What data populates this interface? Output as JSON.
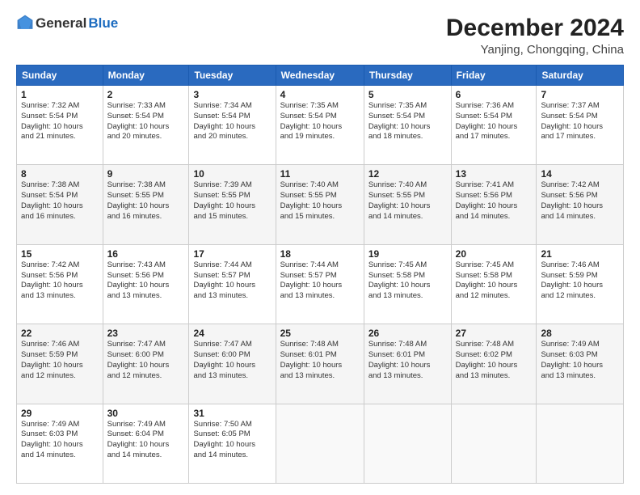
{
  "header": {
    "logo_general": "General",
    "logo_blue": "Blue",
    "month_title": "December 2024",
    "location": "Yanjing, Chongqing, China"
  },
  "days_of_week": [
    "Sunday",
    "Monday",
    "Tuesday",
    "Wednesday",
    "Thursday",
    "Friday",
    "Saturday"
  ],
  "weeks": [
    [
      {
        "day": "1",
        "info": "Sunrise: 7:32 AM\nSunset: 5:54 PM\nDaylight: 10 hours\nand 21 minutes."
      },
      {
        "day": "2",
        "info": "Sunrise: 7:33 AM\nSunset: 5:54 PM\nDaylight: 10 hours\nand 20 minutes."
      },
      {
        "day": "3",
        "info": "Sunrise: 7:34 AM\nSunset: 5:54 PM\nDaylight: 10 hours\nand 20 minutes."
      },
      {
        "day": "4",
        "info": "Sunrise: 7:35 AM\nSunset: 5:54 PM\nDaylight: 10 hours\nand 19 minutes."
      },
      {
        "day": "5",
        "info": "Sunrise: 7:35 AM\nSunset: 5:54 PM\nDaylight: 10 hours\nand 18 minutes."
      },
      {
        "day": "6",
        "info": "Sunrise: 7:36 AM\nSunset: 5:54 PM\nDaylight: 10 hours\nand 17 minutes."
      },
      {
        "day": "7",
        "info": "Sunrise: 7:37 AM\nSunset: 5:54 PM\nDaylight: 10 hours\nand 17 minutes."
      }
    ],
    [
      {
        "day": "8",
        "info": "Sunrise: 7:38 AM\nSunset: 5:54 PM\nDaylight: 10 hours\nand 16 minutes."
      },
      {
        "day": "9",
        "info": "Sunrise: 7:38 AM\nSunset: 5:55 PM\nDaylight: 10 hours\nand 16 minutes."
      },
      {
        "day": "10",
        "info": "Sunrise: 7:39 AM\nSunset: 5:55 PM\nDaylight: 10 hours\nand 15 minutes."
      },
      {
        "day": "11",
        "info": "Sunrise: 7:40 AM\nSunset: 5:55 PM\nDaylight: 10 hours\nand 15 minutes."
      },
      {
        "day": "12",
        "info": "Sunrise: 7:40 AM\nSunset: 5:55 PM\nDaylight: 10 hours\nand 14 minutes."
      },
      {
        "day": "13",
        "info": "Sunrise: 7:41 AM\nSunset: 5:56 PM\nDaylight: 10 hours\nand 14 minutes."
      },
      {
        "day": "14",
        "info": "Sunrise: 7:42 AM\nSunset: 5:56 PM\nDaylight: 10 hours\nand 14 minutes."
      }
    ],
    [
      {
        "day": "15",
        "info": "Sunrise: 7:42 AM\nSunset: 5:56 PM\nDaylight: 10 hours\nand 13 minutes."
      },
      {
        "day": "16",
        "info": "Sunrise: 7:43 AM\nSunset: 5:56 PM\nDaylight: 10 hours\nand 13 minutes."
      },
      {
        "day": "17",
        "info": "Sunrise: 7:44 AM\nSunset: 5:57 PM\nDaylight: 10 hours\nand 13 minutes."
      },
      {
        "day": "18",
        "info": "Sunrise: 7:44 AM\nSunset: 5:57 PM\nDaylight: 10 hours\nand 13 minutes."
      },
      {
        "day": "19",
        "info": "Sunrise: 7:45 AM\nSunset: 5:58 PM\nDaylight: 10 hours\nand 13 minutes."
      },
      {
        "day": "20",
        "info": "Sunrise: 7:45 AM\nSunset: 5:58 PM\nDaylight: 10 hours\nand 12 minutes."
      },
      {
        "day": "21",
        "info": "Sunrise: 7:46 AM\nSunset: 5:59 PM\nDaylight: 10 hours\nand 12 minutes."
      }
    ],
    [
      {
        "day": "22",
        "info": "Sunrise: 7:46 AM\nSunset: 5:59 PM\nDaylight: 10 hours\nand 12 minutes."
      },
      {
        "day": "23",
        "info": "Sunrise: 7:47 AM\nSunset: 6:00 PM\nDaylight: 10 hours\nand 12 minutes."
      },
      {
        "day": "24",
        "info": "Sunrise: 7:47 AM\nSunset: 6:00 PM\nDaylight: 10 hours\nand 13 minutes."
      },
      {
        "day": "25",
        "info": "Sunrise: 7:48 AM\nSunset: 6:01 PM\nDaylight: 10 hours\nand 13 minutes."
      },
      {
        "day": "26",
        "info": "Sunrise: 7:48 AM\nSunset: 6:01 PM\nDaylight: 10 hours\nand 13 minutes."
      },
      {
        "day": "27",
        "info": "Sunrise: 7:48 AM\nSunset: 6:02 PM\nDaylight: 10 hours\nand 13 minutes."
      },
      {
        "day": "28",
        "info": "Sunrise: 7:49 AM\nSunset: 6:03 PM\nDaylight: 10 hours\nand 13 minutes."
      }
    ],
    [
      {
        "day": "29",
        "info": "Sunrise: 7:49 AM\nSunset: 6:03 PM\nDaylight: 10 hours\nand 14 minutes."
      },
      {
        "day": "30",
        "info": "Sunrise: 7:49 AM\nSunset: 6:04 PM\nDaylight: 10 hours\nand 14 minutes."
      },
      {
        "day": "31",
        "info": "Sunrise: 7:50 AM\nSunset: 6:05 PM\nDaylight: 10 hours\nand 14 minutes."
      },
      {
        "day": "",
        "info": ""
      },
      {
        "day": "",
        "info": ""
      },
      {
        "day": "",
        "info": ""
      },
      {
        "day": "",
        "info": ""
      }
    ]
  ]
}
